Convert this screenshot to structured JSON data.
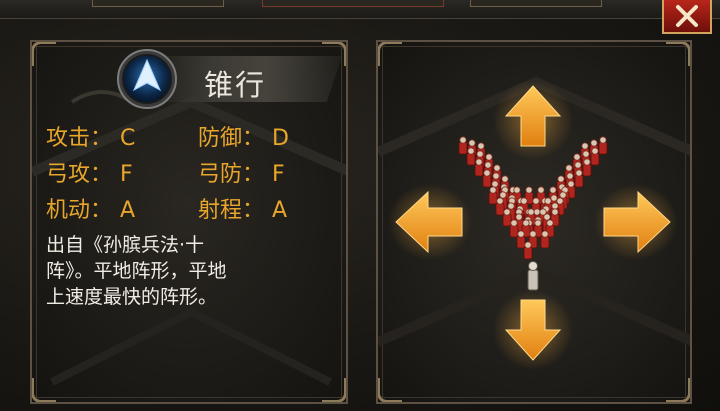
{
  "window": {
    "close_icon": "close-x-icon"
  },
  "formation": {
    "icon": "arrow-up-icon",
    "name": "锥行",
    "stats": [
      {
        "label": "攻击",
        "sep": "：",
        "grade": "C"
      },
      {
        "label": "防御",
        "sep": "：",
        "grade": "D"
      },
      {
        "label": "弓攻",
        "sep": "：",
        "grade": "F"
      },
      {
        "label": "弓防",
        "sep": "：",
        "grade": "F"
      },
      {
        "label": "机动",
        "sep": "：",
        "grade": "A"
      },
      {
        "label": "射程",
        "sep": "：",
        "grade": "A"
      }
    ],
    "description_lines": [
      "出自《孙膑兵法·十",
      "阵》。平地阵形，平地",
      "上速度最快的阵形。"
    ]
  },
  "preview": {
    "shape": "wedge",
    "direction_arrows": [
      "up-arrow-icon",
      "left-arrow-icon",
      "right-arrow-icon",
      "down-arrow-icon"
    ]
  },
  "colors": {
    "stat_text": "#e8a62a",
    "arrow": "#f0a21e",
    "close_button": "#b8261b"
  }
}
